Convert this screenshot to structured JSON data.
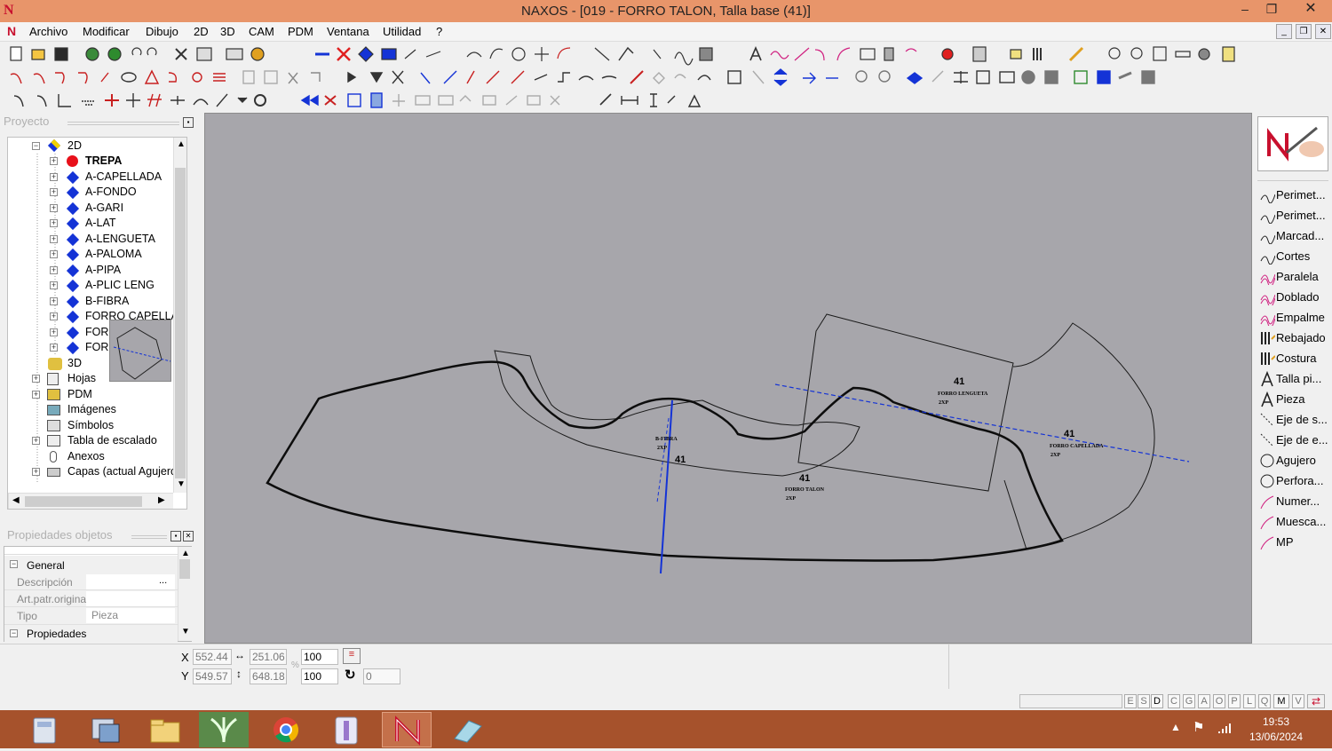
{
  "window": {
    "title": "NAXOS - [019 - FORRO TALON, Talla base (41)]",
    "minimize": "–",
    "maximize": "❐",
    "close": "✕"
  },
  "menu": [
    "Archivo",
    "Modificar",
    "Dibujo",
    "2D",
    "3D",
    "CAM",
    "PDM",
    "Ventana",
    "Utilidad",
    "?"
  ],
  "panels": {
    "project_title": "Proyecto",
    "props_title": "Propiedades objetos"
  },
  "tree": {
    "root": "2D",
    "items": [
      "TREPA",
      "A-CAPELLADA",
      "A-FONDO",
      "A-GARI",
      "A-LAT",
      "A-LENGUETA",
      "A-PALOMA",
      "A-PIPA",
      "A-PLIC LENG",
      "B-FIBRA",
      "FORRO CAPELLA",
      "FORI",
      "FORI"
    ],
    "others": [
      "3D",
      "Hojas",
      "PDM",
      "Imágenes",
      "Símbolos",
      "Tabla de escalado",
      "Anexos",
      "Capas (actual Agujeros"
    ]
  },
  "props": {
    "section_general": "General",
    "rows": [
      {
        "label": "Descripción",
        "value": "",
        "button": "..."
      },
      {
        "label": "Art.patr.original",
        "value": ""
      },
      {
        "label": "Tipo",
        "value": "Pieza"
      }
    ],
    "section_props": "Propiedades"
  },
  "right_tools": [
    "Perimet...",
    "Perimet...",
    "Marcad...",
    "Cortes",
    "Paralela",
    "Doblado",
    "Empalme",
    "Rebajado",
    "Costura",
    "Talla pi...",
    "Pieza",
    "Eje de s...",
    "Eje de e...",
    "Agujero",
    "Perfora...",
    "Numer...",
    "Muesca...",
    "MP"
  ],
  "canvas_labels": {
    "size1": "41",
    "piece1": "B-FIBRA",
    "qty1": "2XP",
    "size2": "41",
    "piece2": "FORRO TALON",
    "qty2": "2XP",
    "size3": "41",
    "piece3": "FORRO LENGUETA",
    "qty3": "2XP",
    "size4": "41",
    "piece4": "FORRO CAPELLADA",
    "qty4": "2XP"
  },
  "status": {
    "x_label": "X",
    "y_label": "Y",
    "x": "552.44",
    "y": "549.57",
    "w": "251.06",
    "h": "648.18",
    "sx": "100",
    "sy": "100",
    "rot": "0",
    "pct": "%"
  },
  "keys": [
    "E",
    "S",
    "D",
    "C",
    "G",
    "A",
    "O",
    "P",
    "L",
    "Q",
    "M",
    "V"
  ],
  "clock": {
    "time": "19:53",
    "date": "13/06/2024"
  },
  "colors": {
    "titlebar": "#e8956a",
    "canvas": "#a7a6ab",
    "taskbar": "#a6522c",
    "accent_blue": "#1433d6"
  }
}
